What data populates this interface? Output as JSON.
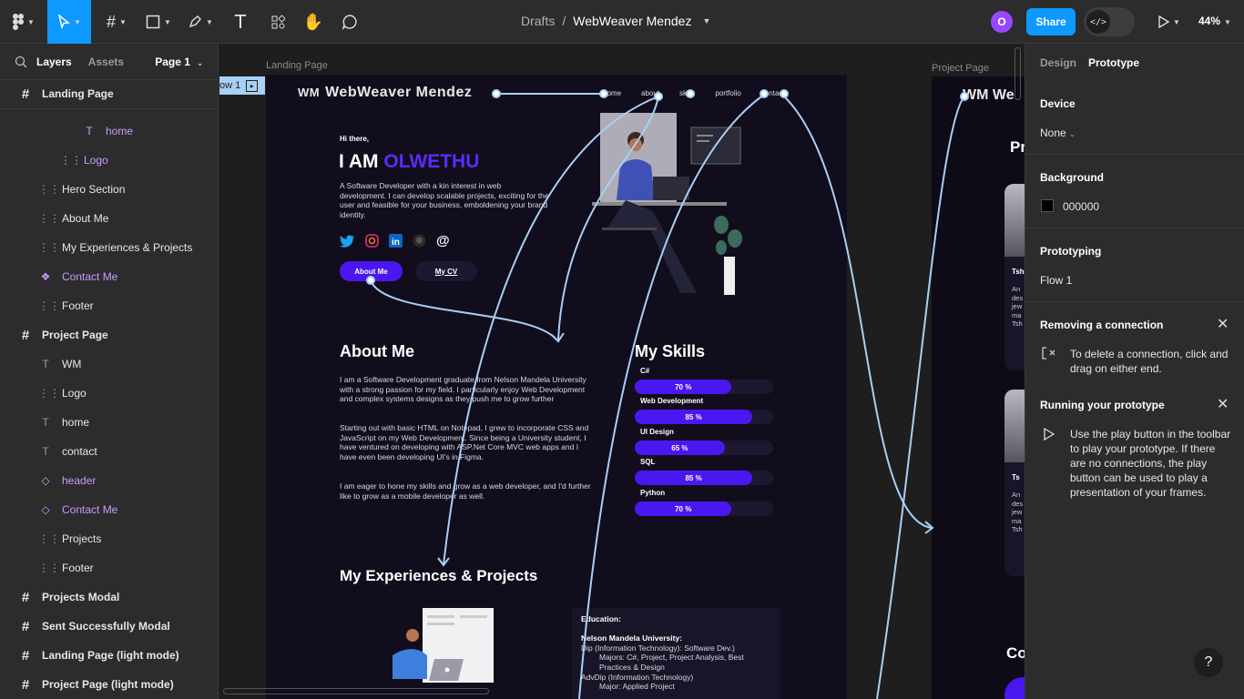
{
  "topbar": {
    "breadcrumb_root": "Drafts",
    "breadcrumb_sep": "/",
    "file_name": "WebWeaver Mendez",
    "avatar_initial": "O",
    "share_label": "Share",
    "zoom": "44%",
    "dev_mode_icon": "</>"
  },
  "left_panel": {
    "tabs": [
      "Layers",
      "Assets"
    ],
    "page_selector": "Page 1",
    "layers": [
      {
        "label": "Landing Page",
        "icon": "frame-icon"
      },
      {
        "label": "home",
        "icon": "text-icon"
      },
      {
        "label": "Logo",
        "icon": "group-icon"
      },
      {
        "label": "Hero Section",
        "icon": "group-icon"
      },
      {
        "label": "About Me",
        "icon": "group-icon"
      },
      {
        "label": "My Experiences & Projects",
        "icon": "group-icon"
      },
      {
        "label": "Contact Me",
        "icon": "component-icon"
      },
      {
        "label": "Footer",
        "icon": "group-icon"
      },
      {
        "label": "Project Page",
        "icon": "frame-icon"
      },
      {
        "label": "WM",
        "icon": "text-icon"
      },
      {
        "label": "Logo",
        "icon": "group-icon"
      },
      {
        "label": "home",
        "icon": "text-icon"
      },
      {
        "label": "contact",
        "icon": "text-icon"
      },
      {
        "label": "header",
        "icon": "instance-icon"
      },
      {
        "label": "Contact Me",
        "icon": "instance-icon"
      },
      {
        "label": "Projects",
        "icon": "group-icon"
      },
      {
        "label": "Footer",
        "icon": "group-icon"
      },
      {
        "label": "Projects Modal",
        "icon": "frame-icon"
      },
      {
        "label": "Sent Successfully Modal",
        "icon": "frame-icon"
      },
      {
        "label": "Landing Page (light mode)",
        "icon": "frame-icon"
      },
      {
        "label": "Project Page (light mode)",
        "icon": "frame-icon"
      }
    ]
  },
  "canvas": {
    "frame1_label": "Landing Page",
    "frame2_label": "Project Page",
    "flow_tag": "ow 1",
    "site": {
      "logo_mark": "WM",
      "logo_text": "WebWeaver Mendez",
      "nav": [
        "home",
        "about",
        "skills",
        "portfolio",
        "contact"
      ],
      "greeting": "Hi there,",
      "headline_prefix": "I AM ",
      "headline_name": "OLWETHU",
      "intro": "A Software Developer with a kin interest in web development. I can develop scalable projects, exciting for the user and feasible for your business, emboldening your brand identity.",
      "btn_about": "About Me",
      "btn_cv": "My CV",
      "about_title": "About Me",
      "about_p1": "I am a Software Development graduate from Nelson Mandela University with a strong passion for my field. I particularly enjoy Web Development and complex systems designs as they push me to grow further",
      "about_p2": "Starting out with basic HTML on Notepad, I grew to incorporate CSS and JavaScript on my Web Development. Since being a University student, I have ventured on developing with ASP.Net Core MVC web apps and I have even been developing UI's in Figma.",
      "about_p3": "I am eager to hone my skills and grow as a web developer, and I'd further like to grow as a mobile developer as well.",
      "skills_title": "My Skills",
      "skills": [
        {
          "name": "C#",
          "percent": 70,
          "label": "70 %"
        },
        {
          "name": "Web Development",
          "percent": 85,
          "label": "85 %"
        },
        {
          "name": "UI Design",
          "percent": 65,
          "label": "65 %"
        },
        {
          "name": "SQL",
          "percent": 85,
          "label": "85 %"
        },
        {
          "name": "Python",
          "percent": 70,
          "label": "70 %"
        }
      ],
      "exp_title": "My Experiences & Projects",
      "edu_heading": "Education:",
      "edu_school": "Nelson Mandela University:",
      "edu_l1": "Dip (Information Technology):  Software Dev.)",
      "edu_l2": "Majors: C#, Project, Project Analysis, Best",
      "edu_l3": "Practices & Design",
      "edu_l4": "AdvDip (Information Technology)",
      "edu_l5": "Major: Applied Project"
    },
    "project_page_partial": {
      "logo": "WM We",
      "heading_fragment": "Pr",
      "card1_title": "Tsh",
      "card1_lines": [
        "An",
        "des",
        "jew",
        "ma",
        "Tsh"
      ],
      "card2_title": "Ts",
      "card2_lines": [
        "An",
        "des",
        "jew",
        "ma",
        "Tsh"
      ],
      "contact_fragment": "Co"
    }
  },
  "right_panel": {
    "tabs": [
      "Design",
      "Prototype"
    ],
    "device_label": "Device",
    "device_value": "None",
    "background_label": "Background",
    "background_hex": "000000",
    "background_color": "#000000",
    "prototyping_label": "Prototyping",
    "flow_name": "Flow 1",
    "tip1_title": "Removing a connection",
    "tip1_body": "To delete a connection, click and drag on either end.",
    "tip2_title": "Running your prototype",
    "tip2_body": "Use the play button in the toolbar to play your prototype. If there are no connections, the play button can be used to play a presentation of your frames.",
    "help": "?"
  },
  "colors": {
    "accent": "#0d99ff",
    "brand_purple": "#4b17f0",
    "frame_bg": "#120d1c",
    "connector": "#a8d0f5"
  }
}
